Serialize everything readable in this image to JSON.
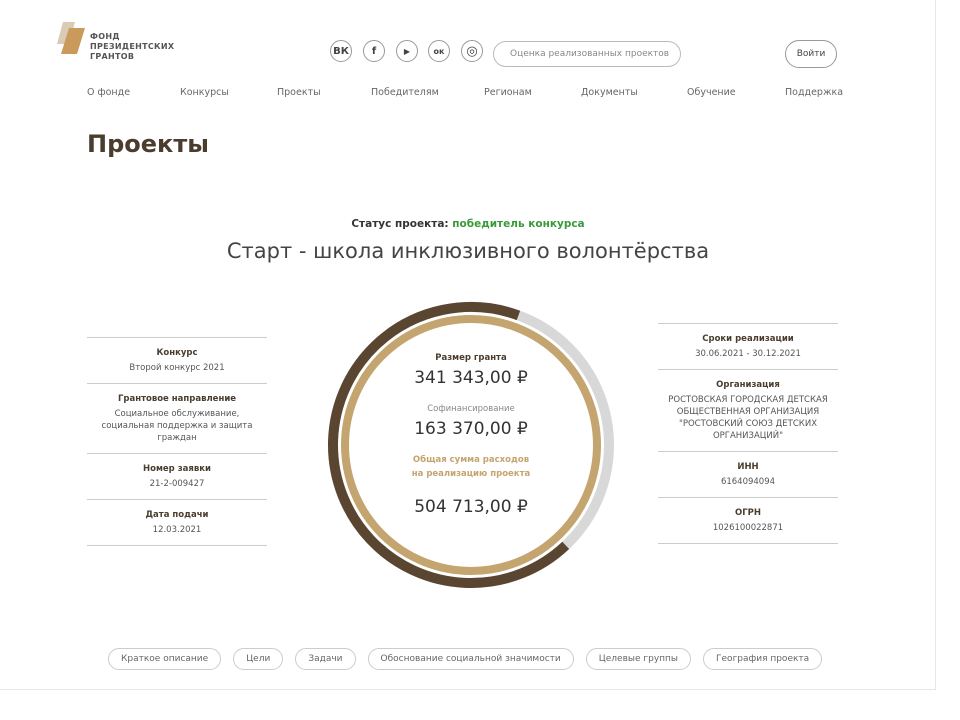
{
  "header": {
    "logo_text": [
      "ФОНД",
      "ПРЕЗИДЕНТСКИХ",
      "ГРАНТОВ"
    ],
    "social": [
      {
        "icon": "vk-icon",
        "glyph": "ВК"
      },
      {
        "icon": "facebook-icon",
        "glyph": "f"
      },
      {
        "icon": "youtube-icon",
        "glyph": "▶"
      },
      {
        "icon": "odnoklassniki-icon",
        "glyph": "ок"
      },
      {
        "icon": "instagram-icon",
        "glyph": "◎"
      }
    ],
    "search_placeholder": "Оценка реализованных проектов",
    "login": "Войти"
  },
  "nav": [
    "О фонде",
    "Конкурсы",
    "Проекты",
    "Победителям",
    "Регионам",
    "Документы",
    "Обучение",
    "Поддержка"
  ],
  "page_title": "Проекты",
  "project": {
    "status_label": "Статус проекта:",
    "status_value": "победитель конкурса",
    "title": "Старт - школа инклюзивного волонтёрства"
  },
  "left": [
    {
      "label": "Конкурс",
      "value": "Второй конкурс 2021"
    },
    {
      "label": "Грантовое направление",
      "value": "Социальное обслуживание, социальная поддержка и защита граждан"
    },
    {
      "label": "Номер заявки",
      "value": "21-2-009427"
    },
    {
      "label": "Дата подачи",
      "value": "12.03.2021"
    }
  ],
  "right": [
    {
      "label": "Сроки реализации",
      "value": "30.06.2021 - 30.12.2021"
    },
    {
      "label": "Организация",
      "value": "РОСТОВСКАЯ ГОРОДСКАЯ ДЕТСКАЯ ОБЩЕСТВЕННАЯ ОРГАНИЗАЦИЯ \"РОСТОВСКИЙ СОЮЗ ДЕТСКИХ ОРГАНИЗАЦИЙ\""
    },
    {
      "label": "ИНН",
      "value": "6164094094"
    },
    {
      "label": "ОГРН",
      "value": "1026100022871"
    }
  ],
  "budget": {
    "grant_label": "Размер гранта",
    "grant": "341 343,00 ₽",
    "cofin_label": "Софинансирование",
    "cofin": "163 370,00 ₽",
    "total_label": "Общая сумма расходов на реализацию проекта",
    "total": "504 713,00 ₽",
    "grant_share": 0.676,
    "colors": {
      "grant": "#5a4630",
      "cofin": "#d8d8d8",
      "inner": "#c4a46f",
      "total_label": "#c4a46f"
    }
  },
  "tabs": [
    "Краткое описание",
    "Цели",
    "Задачи",
    "Обоснование социальной значимости",
    "Целевые группы",
    "География проекта"
  ]
}
